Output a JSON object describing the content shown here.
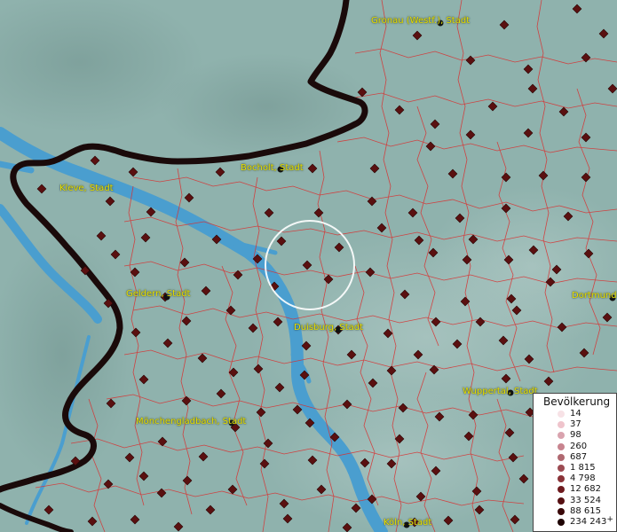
{
  "map": {
    "focus_circle": true,
    "colors": {
      "land": "#8fb2ad",
      "water": "#4a9ecf",
      "district_border": "#d83030",
      "national_border": "#1a0a0a",
      "city_label": "#e8e000",
      "marker": "#5a1010"
    }
  },
  "cities": [
    {
      "label": "Gronau (Westf.), Stadt"
    },
    {
      "label": "Bocholt, Stadt"
    },
    {
      "label": "Kleve, Stadt"
    },
    {
      "label": "Geldern, Stadt"
    },
    {
      "label": "Duisburg, Stadt"
    },
    {
      "label": "Dortmund"
    },
    {
      "label": "Wuppertal, Stadt"
    },
    {
      "label": "Mönchengladbach, Stadt"
    },
    {
      "label": "Köln, Stadt"
    }
  ],
  "legend": {
    "title": "Bevölkerung",
    "items": [
      {
        "label": "14",
        "color": "#f7e2e6"
      },
      {
        "label": "37",
        "color": "#efc4cc"
      },
      {
        "label": "98",
        "color": "#d9a3ae"
      },
      {
        "label": "260",
        "color": "#c8848f"
      },
      {
        "label": "687",
        "color": "#b06870"
      },
      {
        "label": "1 815",
        "color": "#9c4b52"
      },
      {
        "label": "4 798",
        "color": "#8a3338"
      },
      {
        "label": "12 682",
        "color": "#6e1a1e"
      },
      {
        "label": "33 524",
        "color": "#561012"
      },
      {
        "label": "88 615",
        "color": "#3a0809"
      },
      {
        "label": "234 243",
        "color": "#1e0304",
        "suffix": "+"
      }
    ]
  }
}
